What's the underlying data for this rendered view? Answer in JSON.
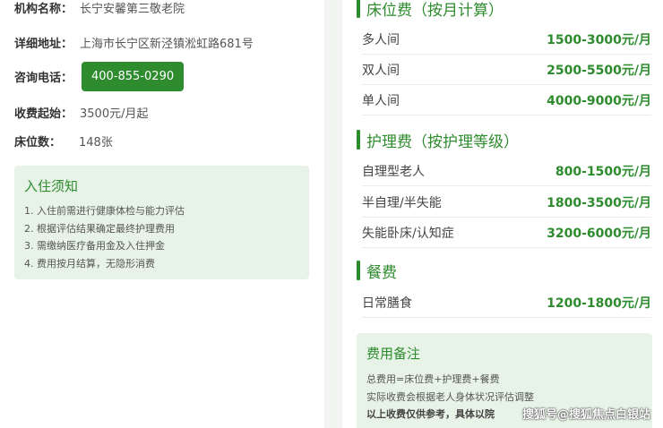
{
  "info": {
    "name_label": "机构名称：",
    "name_value": "长宁安馨第三敬老院",
    "address_label": "详细地址：",
    "address_value": "上海市长宁区新泾镇淞虹路681号",
    "phone_label": "咨询电话：",
    "phone_value": "400-855-0290",
    "fee_label": "收费起始：",
    "fee_value": "3500元/月起",
    "beds_label": "床位数：",
    "beds_value": "148张"
  },
  "notice": {
    "title": "入住须知",
    "items": [
      "1. 入住前需进行健康体检与能力评估",
      "2. 根据评估结果确定最终护理费用",
      "3. 需缴纳医疗备用金及入住押金",
      "4. 费用按月结算，无隐形消费"
    ]
  },
  "bed_fees": {
    "title": "床位费（按月计算）",
    "rows": [
      {
        "name": "多人间",
        "price": "1500-3000元/月"
      },
      {
        "name": "双人间",
        "price": "2500-5500元/月"
      },
      {
        "name": "单人间",
        "price": "4000-9000元/月"
      }
    ]
  },
  "care_fees": {
    "title": "护理费（按护理等级）",
    "rows": [
      {
        "name": "自理型老人",
        "price": "800-1500元/月"
      },
      {
        "name": "半自理/半失能",
        "price": "1800-3500元/月"
      },
      {
        "name": "失能卧床/认知症",
        "price": "3200-6000元/月"
      }
    ]
  },
  "meal_fees": {
    "title": "餐费",
    "rows": [
      {
        "name": "日常膳食",
        "price": "1200-1800元/月"
      }
    ]
  },
  "remark": {
    "title": "费用备注",
    "lines": [
      "总费用=床位费+护理费+餐费",
      "实际收费会根据老人身体状况评估调整",
      "以上收费仅供参考，具体以院"
    ]
  },
  "watermark": "搜狐号@搜狐焦点白银站",
  "colors": {
    "accent": "#2e8b2e",
    "panel_bg": "#e8f3e7",
    "divider_bg": "#f3f5f3"
  }
}
